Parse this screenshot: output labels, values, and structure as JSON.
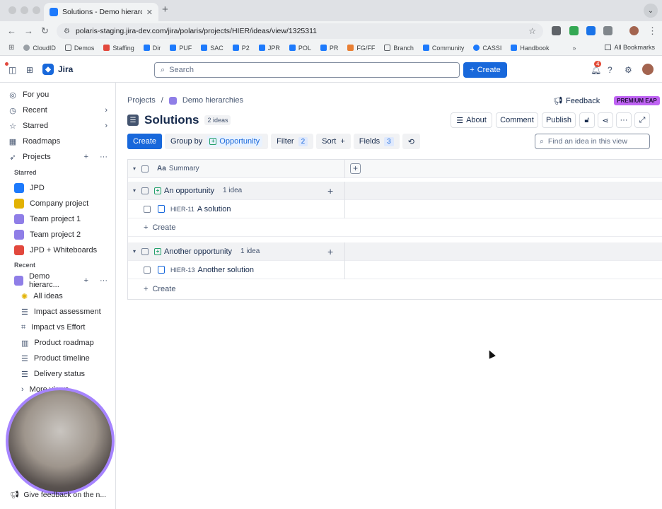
{
  "browser": {
    "tab_title": "Solutions - Demo hierarchies",
    "url": "polaris-staging.jira-dev.com/jira/polaris/projects/HIER/ideas/view/1325311",
    "bookmarks": [
      "CloudID",
      "Demos",
      "Staffing",
      "Dir",
      "PUF",
      "SAC",
      "P2",
      "JPR",
      "POL",
      "PR",
      "FG/FF",
      "Branch",
      "Community",
      "CASSI",
      "Handbook"
    ],
    "all_bookmarks_label": "All Bookmarks"
  },
  "topnav": {
    "app_name": "Jira",
    "search_placeholder": "Search",
    "create_label": "Create",
    "notification_count": "4"
  },
  "sidebar": {
    "items": [
      {
        "label": "For you",
        "icon": "person-icon"
      },
      {
        "label": "Recent",
        "icon": "clock-icon"
      },
      {
        "label": "Starred",
        "icon": "star-icon"
      },
      {
        "label": "Roadmaps",
        "icon": "roadmap-icon"
      },
      {
        "label": "Projects",
        "icon": "rocket-icon"
      }
    ],
    "starred_heading": "Starred",
    "starred_projects": [
      {
        "label": "JPD",
        "color": "#1d7afc"
      },
      {
        "label": "Company project",
        "color": "#e2b203"
      },
      {
        "label": "Team project 1",
        "color": "#8f7ee7"
      },
      {
        "label": "Team project 2",
        "color": "#8f7ee7"
      },
      {
        "label": "JPD + Whiteboards",
        "color": "#e2483d"
      }
    ],
    "recent_heading": "Recent",
    "recent_project": "Demo hierarchies",
    "recent_project_display": "Demo hierarc...",
    "views": [
      {
        "label": "All ideas",
        "icon": "lightbulb-icon"
      },
      {
        "label": "Impact assessment",
        "icon": "list-icon"
      },
      {
        "label": "Impact vs Effort",
        "icon": "matrix-icon"
      },
      {
        "label": "Product roadmap",
        "icon": "board-icon"
      },
      {
        "label": "Product timeline",
        "icon": "timeline-icon"
      },
      {
        "label": "Delivery status",
        "icon": "list-icon"
      }
    ],
    "more_views": "More views",
    "give_feedback": "Give feedback on the n..."
  },
  "page": {
    "breadcrumb_projects": "Projects",
    "breadcrumb_project": "Demo hierarchies",
    "feedback_label": "Feedback",
    "premium_label": "PREMIUM EAP",
    "title": "Solutions",
    "idea_count": "2 ideas",
    "about_label": "About",
    "comment_label": "Comment",
    "publish_label": "Publish"
  },
  "viewbar": {
    "create": "Create",
    "group_by": "Group by",
    "group_value": "Opportunity",
    "filter": "Filter",
    "filter_count": "2",
    "sort": "Sort",
    "fields": "Fields",
    "fields_count": "3",
    "find_placeholder": "Find an idea in this view"
  },
  "table": {
    "summary_header": "Summary",
    "groups": [
      {
        "name": "An opportunity",
        "count": "1 idea",
        "ideas": [
          {
            "key": "HIER-11",
            "summary": "A solution"
          }
        ],
        "create": "Create"
      },
      {
        "name": "Another opportunity",
        "count": "1 idea",
        "ideas": [
          {
            "key": "HIER-13",
            "summary": "Another solution"
          }
        ],
        "create": "Create"
      }
    ]
  }
}
